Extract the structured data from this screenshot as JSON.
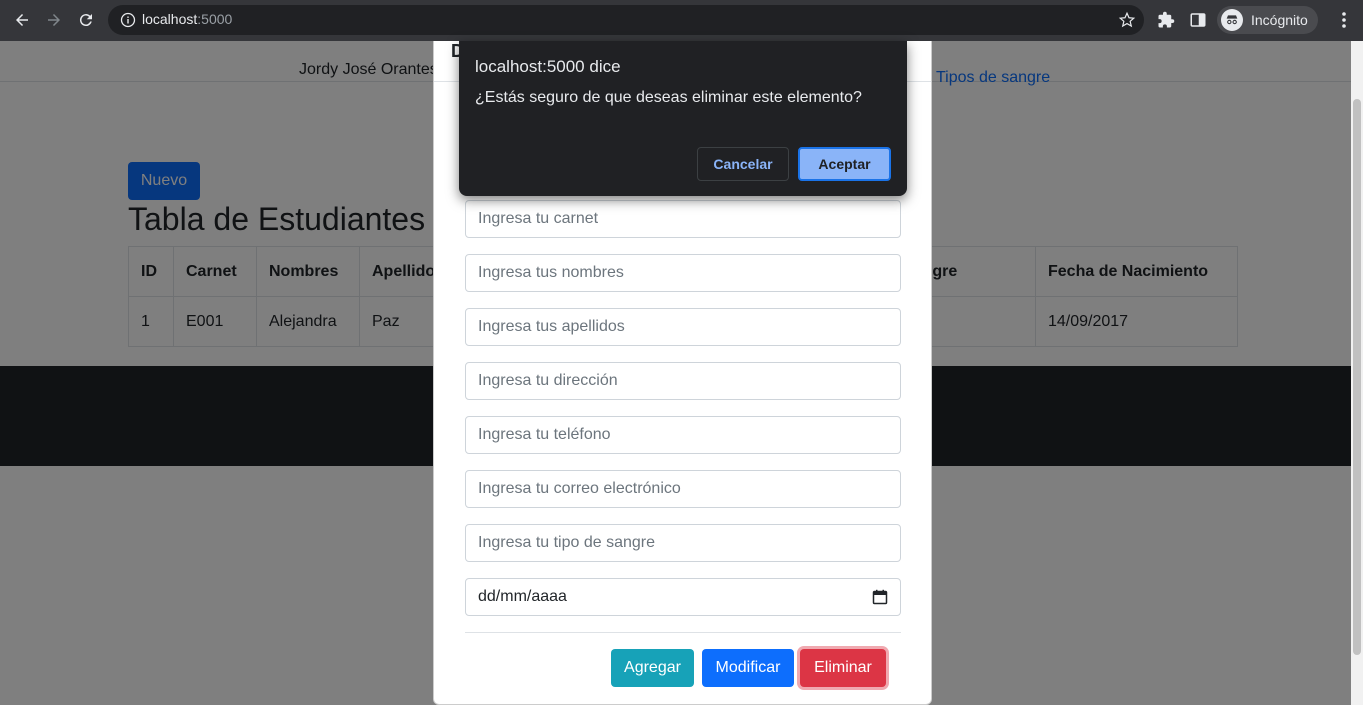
{
  "browser": {
    "url_host": "localhost",
    "url_port": ":5000",
    "incognito_label": "Incógnito"
  },
  "page": {
    "author": "Jordy José Orantes",
    "nav_link": "Tipos de sangre",
    "new_button": "Nuevo",
    "table_title": "Tabla de Estudiantes",
    "table": {
      "headers": [
        "ID",
        "Carnet",
        "Nombres",
        "Apellidos",
        "",
        "",
        "",
        "Tipo de Sangre",
        "Fecha de Nacimiento"
      ],
      "rows": [
        [
          "1",
          "E001",
          "Alejandra",
          "Paz",
          "",
          "",
          "",
          "",
          "14/09/2017"
        ]
      ]
    }
  },
  "modal": {
    "title": "D",
    "fields": {
      "carnet_placeholder": "Ingresa tu carnet",
      "nombres_placeholder": "Ingresa tus nombres",
      "apellidos_placeholder": "Ingresa tus apellidos",
      "direccion_placeholder": "Ingresa tu dirección",
      "telefono_placeholder": "Ingresa tu teléfono",
      "correo_placeholder": "Ingresa tu correo electrónico",
      "sangre_placeholder": "Ingresa tu tipo de sangre",
      "fecha_placeholder": "dd/mm/aaaa"
    },
    "buttons": {
      "add": "Agregar",
      "modify": "Modificar",
      "delete": "Eliminar"
    }
  },
  "alert": {
    "title": "localhost:5000 dice",
    "message": "¿Estás seguro de que deseas eliminar este elemento?",
    "cancel": "Cancelar",
    "ok": "Aceptar"
  }
}
